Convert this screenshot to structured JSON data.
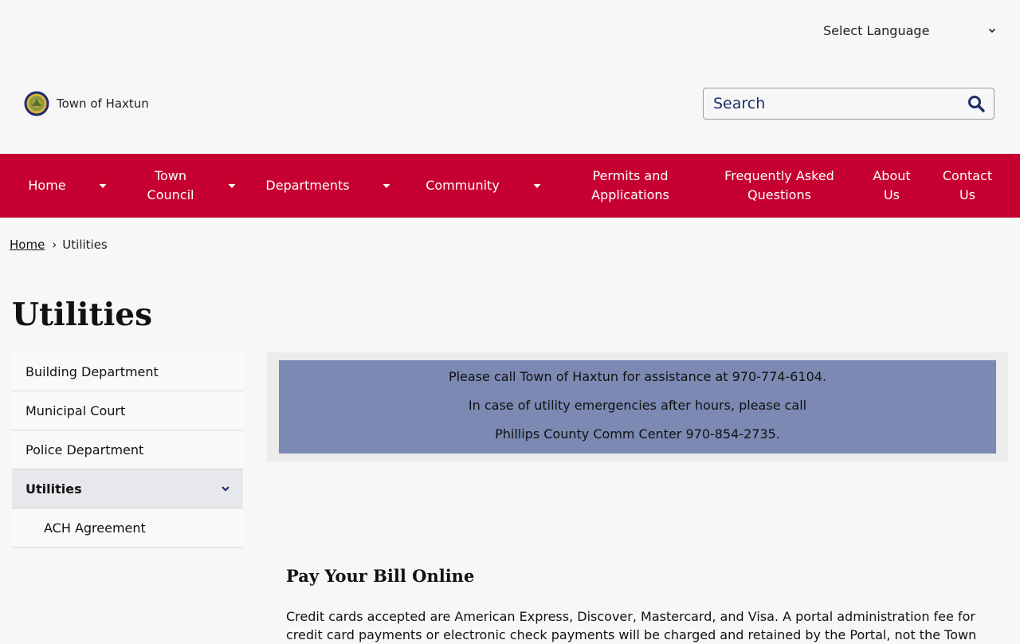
{
  "header": {
    "language_select": "Select Language",
    "site_name": "Town of Haxtun",
    "search_placeholder": "Search"
  },
  "nav": {
    "items": [
      {
        "label": "Home"
      },
      {
        "label": "Town Council"
      },
      {
        "label": "Departments"
      },
      {
        "label": "Community"
      },
      {
        "label": "Permits and Applications"
      },
      {
        "label": "Frequently Asked Questions"
      },
      {
        "label": "About Us"
      },
      {
        "label": "Contact Us"
      }
    ]
  },
  "breadcrumb": {
    "home": "Home",
    "separator": "›",
    "current": "Utilities"
  },
  "page_title": "Utilities",
  "sidebar": {
    "items": [
      {
        "label": "Building Department"
      },
      {
        "label": "Municipal Court"
      },
      {
        "label": "Police Department"
      },
      {
        "label": "Utilities"
      },
      {
        "label": "ACH Agreement"
      }
    ]
  },
  "alert": {
    "line1": "Please call Town of Haxtun for assistance at 970-774-6104.",
    "line2": "In case of utility emergencies after hours, please call",
    "line3": "Phillips County Comm Center 970-854-2735."
  },
  "content": {
    "heading": "Pay Your Bill Online",
    "paragraph": "Credit cards accepted are American Express, Discover, Mastercard, and Visa. A portal administration fee for credit card payments or electronic check payments will be charged and retained by the Portal, not the Town"
  },
  "colors": {
    "nav_bg": "#c60031",
    "alert_bg": "#7b89b3",
    "search_text": "#1d2d6b"
  }
}
